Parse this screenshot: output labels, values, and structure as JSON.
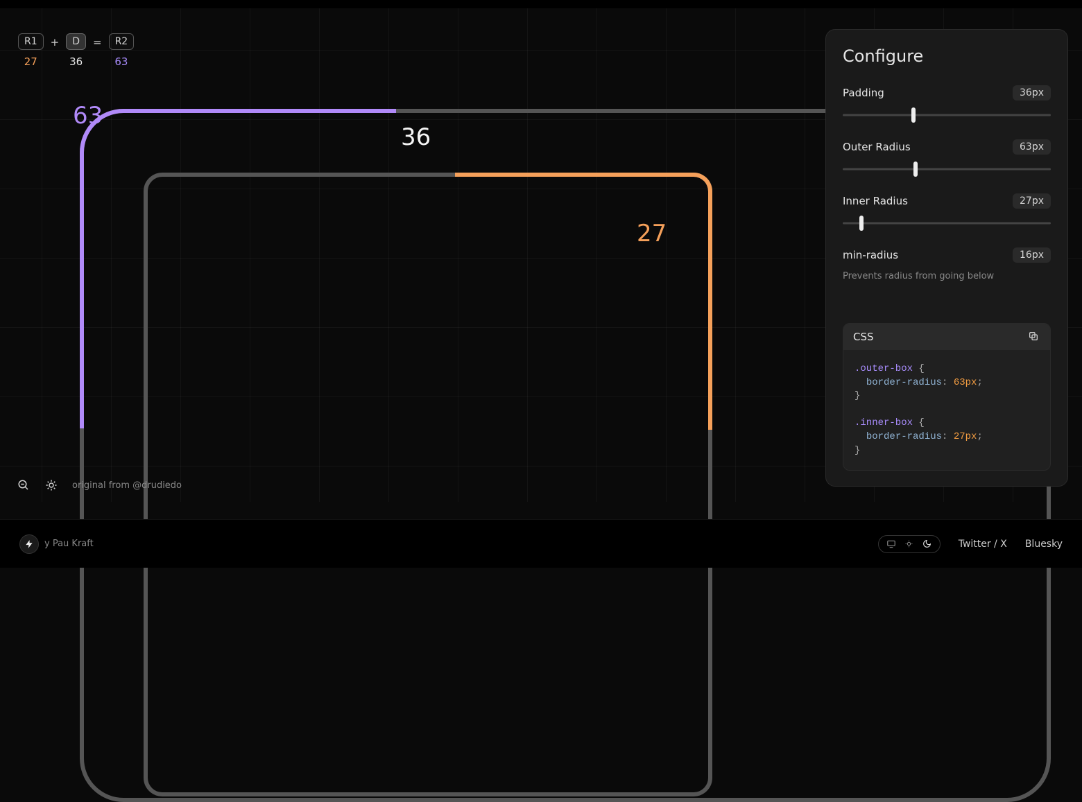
{
  "formula": {
    "r1_chip": "R1",
    "plus": "+",
    "d_chip": "D",
    "equals": "=",
    "r2_chip": "R2",
    "r1_val": "27",
    "d_val": "36",
    "r2_val": "63"
  },
  "canvas_labels": {
    "outer": "63",
    "padding": "36",
    "inner": "27"
  },
  "controls_bottom": {
    "credit": "original from @drudiedo"
  },
  "panel": {
    "title": "Configure",
    "padding": {
      "label": "Padding",
      "value": "36px",
      "percent": 34
    },
    "outer": {
      "label": "Outer Radius",
      "value": "63px",
      "percent": 35
    },
    "inner": {
      "label": "Inner Radius",
      "value": "27px",
      "percent": 9
    },
    "min": {
      "label": "min-radius",
      "value": "16px",
      "help": "Prevents radius from going below"
    },
    "css": {
      "heading": "CSS",
      "outer_sel": ".outer-box",
      "inner_sel": ".inner-box",
      "prop": "border-radius",
      "outer_val": "63px",
      "inner_val": "27px"
    }
  },
  "footer": {
    "by": "y Pau Kraft",
    "links": {
      "twitter": "Twitter / X",
      "bluesky": "Bluesky"
    }
  }
}
